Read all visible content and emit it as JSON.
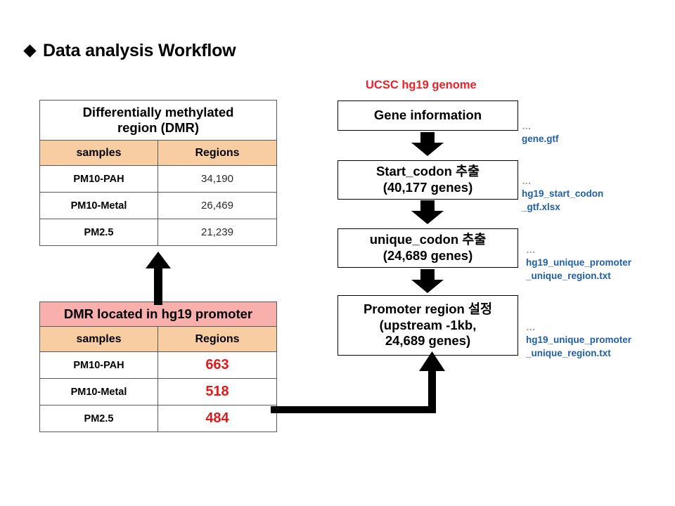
{
  "slide": {
    "title": "Data analysis Workflow",
    "bullet_icon": "diamond-bullet-icon"
  },
  "tables": {
    "dmr": {
      "title": "Differentially  methylated\nregion (DMR)",
      "columns": [
        "samples",
        "Regions"
      ],
      "rows": [
        {
          "sample": "PM10-PAH",
          "regions": "34,190"
        },
        {
          "sample": "PM10-Metal",
          "regions": "26,469"
        },
        {
          "sample": "PM2.5",
          "regions": "21,239"
        }
      ]
    },
    "dmr_promoter": {
      "title": "DMR located in hg19 promoter",
      "columns": [
        "samples",
        "Regions"
      ],
      "rows": [
        {
          "sample": "PM10-PAH",
          "regions": "663"
        },
        {
          "sample": "PM10-Metal",
          "regions": "518"
        },
        {
          "sample": "PM2.5",
          "regions": "484"
        }
      ]
    }
  },
  "flow": {
    "source_label": "UCSC hg19 genome",
    "steps": [
      {
        "label": "Gene information"
      },
      {
        "label": "Start_codon 추출\n(40,177 genes)"
      },
      {
        "label": "unique_codon 추출\n(24,689 genes)"
      },
      {
        "label": "Promoter region 설정\n(upstream -1kb,\n24,689 genes)"
      }
    ],
    "notes": [
      {
        "dots": "…",
        "file": "gene.gtf"
      },
      {
        "dots": "…",
        "file": "hg19_start_codon\n_gtf.xlsx"
      },
      {
        "dots": "…",
        "file": "hg19_unique_promoter\n_unique_region.txt"
      },
      {
        "dots": "…",
        "file": "hg19_unique_promoter\n_unique_region.txt"
      }
    ]
  },
  "colors": {
    "header_peach": "#F9CDA2",
    "header_pink": "#F9B0AD",
    "red_accent": "#E8232A",
    "red_value": "#E01B1B",
    "blue_filename": "#1F5FA8",
    "gray_dots": "#9B9B9B"
  }
}
